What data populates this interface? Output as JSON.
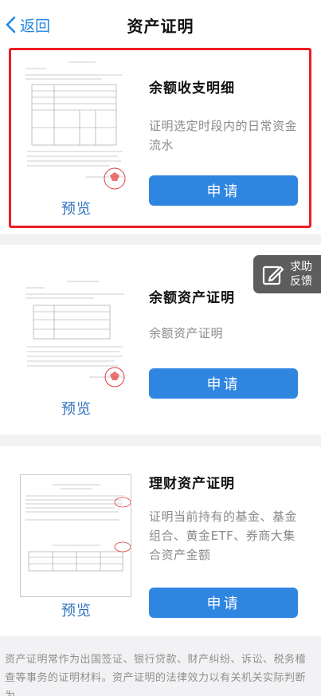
{
  "nav": {
    "back_label": "返回",
    "title": "资产证明"
  },
  "cards": [
    {
      "title": "余额收支明细",
      "desc": "证明选定时段内的日常资金流水",
      "apply_label": "申请",
      "preview_label": "预览"
    },
    {
      "title": "余额资产证明",
      "desc": "余额资产证明",
      "apply_label": "申请",
      "preview_label": "预览"
    },
    {
      "title": "理财资产证明",
      "desc": "证明当前持有的基金、基金组合、黄金ETF、券商大集合资产金额",
      "apply_label": "申请",
      "preview_label": "预览"
    }
  ],
  "help": {
    "line1": "求助",
    "line2": "反馈"
  },
  "footer": {
    "text": "资产证明常作为出国签证、银行贷款、财产纠纷、诉讼、税务稽查等事务的证明材料。资产证明的法律效力以有关机关实际判断为"
  },
  "colors": {
    "accent": "#2f86e0",
    "highlight": "#ee1c25",
    "link": "#1f86e6"
  }
}
